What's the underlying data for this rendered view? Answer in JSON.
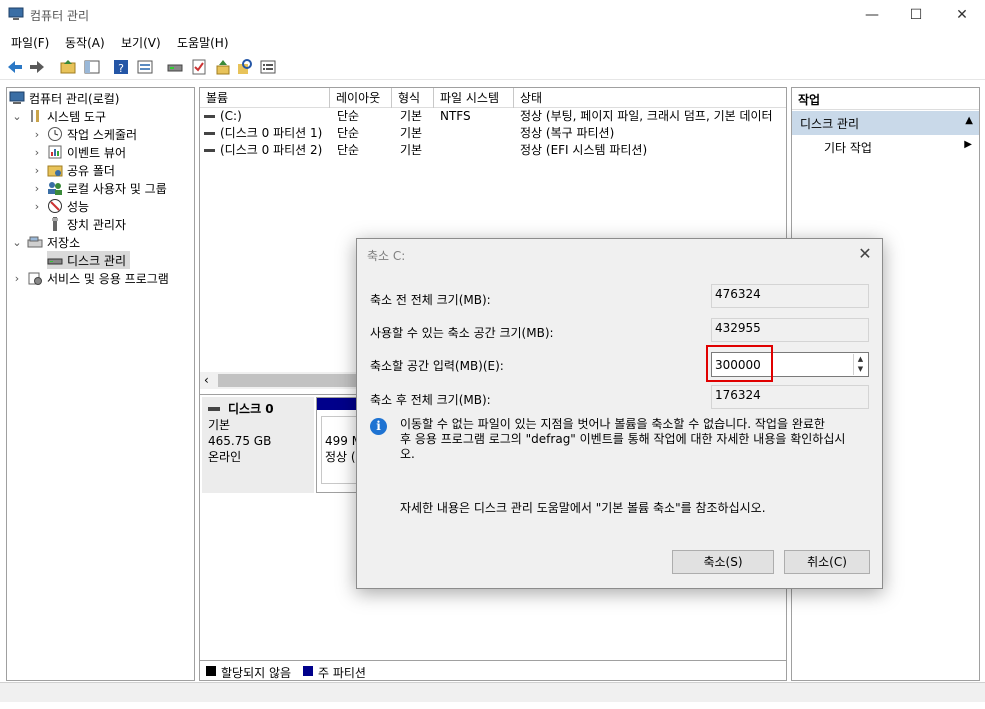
{
  "window": {
    "title": "컴퓨터 관리",
    "minimize": "—",
    "maximize": "☐",
    "close": "✕"
  },
  "menu": [
    "파일(F)",
    "동작(A)",
    "보기(V)",
    "도움말(H)"
  ],
  "tree": {
    "root": "컴퓨터 관리(로컬)",
    "system_tools": "시스템 도구",
    "task_scheduler": "작업 스케줄러",
    "event_viewer": "이벤트 뷰어",
    "shared_folders": "공유 폴더",
    "local_users": "로컬 사용자 및 그룹",
    "performance": "성능",
    "device_manager": "장치 관리자",
    "storage": "저장소",
    "disk_management": "디스크 관리",
    "services": "서비스 및 응용 프로그램"
  },
  "volume_list": {
    "columns": [
      "볼륨",
      "레이아웃",
      "형식",
      "파일 시스템",
      "상태"
    ],
    "rows": [
      {
        "volume": "(C:)",
        "layout": "단순",
        "type": "기본",
        "fs": "NTFS",
        "status": "정상 (부팅, 페이지 파일, 크래시 덤프, 기본 데이터"
      },
      {
        "volume": "(디스크 0 파티션 1)",
        "layout": "단순",
        "type": "기본",
        "fs": "",
        "status": "정상 (복구 파티션)"
      },
      {
        "volume": "(디스크 0 파티션 2)",
        "layout": "단순",
        "type": "기본",
        "fs": "",
        "status": "정상 (EFI 시스템 파티션)"
      }
    ]
  },
  "disk": {
    "name": "디스크 0",
    "kind": "기본",
    "size": "465.75 GB",
    "state": "온라인",
    "partition_size": "499 M",
    "partition_status": "정상 ("
  },
  "legend": {
    "unallocated": "할당되지 않음",
    "primary": "주 파티션",
    "unallocated_color": "#000000",
    "primary_color": "#00008b"
  },
  "actions": {
    "header": "작업",
    "section": "디스크 관리",
    "more": "기타 작업"
  },
  "dialog": {
    "title": "축소 C:",
    "total_before_label": "축소 전 전체 크기(MB):",
    "total_before": "476324",
    "available_label": "사용할 수 있는 축소 공간 크기(MB):",
    "available": "432955",
    "amount_label": "축소할 공간 입력(MB)(E):",
    "amount": "300000",
    "total_after_label": "축소 후 전체 크기(MB):",
    "total_after": "176324",
    "info_line1": "이동할 수 없는 파일이 있는 지점을 벗어나 볼륨을 축소할 수 없습니다. 작업을 완료한",
    "info_line2": "후 응용 프로그램 로그의 \"defrag\" 이벤트를 통해 작업에 대한 자세한 내용을 확인하십시",
    "info_line3": "오.",
    "help": "자세한 내용은 디스크 관리 도움말에서 \"기본 볼륨 축소\"를 참조하십시오.",
    "shrink_button": "축소(S)",
    "cancel_button": "취소(C)"
  }
}
